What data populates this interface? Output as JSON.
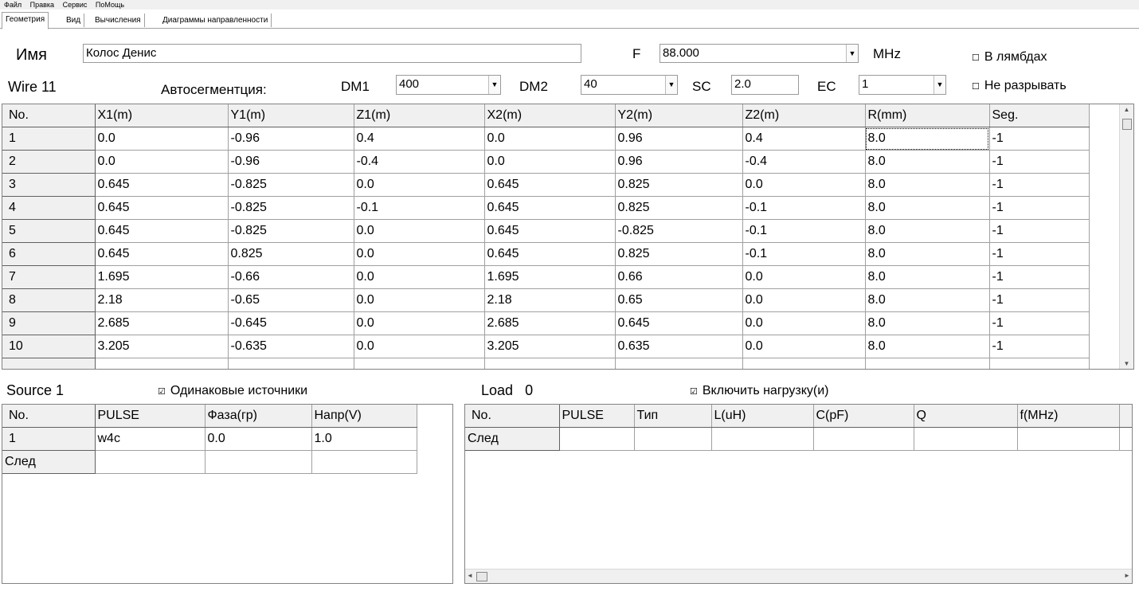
{
  "menu": [
    "Файл",
    "Правка",
    "Сервис",
    "ПоМощь"
  ],
  "tabs": [
    "Геометрия",
    "Вид",
    "Вычисления",
    "Диаграммы направленности"
  ],
  "name_label": "Имя",
  "name_value": "Колос Денис",
  "freq_label": "F",
  "freq_value": "88.000",
  "freq_unit": "MHz",
  "lambda_label": "В лямбдах",
  "no_break_label": "Не разрывать",
  "wire_label": "Wire 11",
  "autoseg_label": "Автосегментция:",
  "dm1_label": "DM1",
  "dm1_value": "400",
  "dm2_label": "DM2",
  "dm2_value": "40",
  "sc_label": "SC",
  "sc_value": "2.0",
  "ec_label": "EC",
  "ec_value": "1",
  "wires": {
    "headers": [
      "No.",
      "X1(m)",
      "Y1(m)",
      "Z1(m)",
      "X2(m)",
      "Y2(m)",
      "Z2(m)",
      "R(mm)",
      "Seg."
    ],
    "rows": [
      [
        "1",
        "0.0",
        "-0.96",
        "0.4",
        "0.0",
        "0.96",
        "0.4",
        "8.0",
        "-1"
      ],
      [
        "2",
        "0.0",
        "-0.96",
        "-0.4",
        "0.0",
        "0.96",
        "-0.4",
        "8.0",
        "-1"
      ],
      [
        "3",
        "0.645",
        "-0.825",
        "0.0",
        "0.645",
        "0.825",
        "0.0",
        "8.0",
        "-1"
      ],
      [
        "4",
        "0.645",
        "-0.825",
        "-0.1",
        "0.645",
        "0.825",
        "-0.1",
        "8.0",
        "-1"
      ],
      [
        "5",
        "0.645",
        "-0.825",
        "0.0",
        "0.645",
        "-0.825",
        "-0.1",
        "8.0",
        "-1"
      ],
      [
        "6",
        "0.645",
        "0.825",
        "0.0",
        "0.645",
        "0.825",
        "-0.1",
        "8.0",
        "-1"
      ],
      [
        "7",
        "1.695",
        "-0.66",
        "0.0",
        "1.695",
        "0.66",
        "0.0",
        "8.0",
        "-1"
      ],
      [
        "8",
        "2.18",
        "-0.65",
        "0.0",
        "2.18",
        "0.65",
        "0.0",
        "8.0",
        "-1"
      ],
      [
        "9",
        "2.685",
        "-0.645",
        "0.0",
        "2.685",
        "0.645",
        "0.0",
        "8.0",
        "-1"
      ],
      [
        "10",
        "3.205",
        "-0.635",
        "0.0",
        "3.205",
        "0.635",
        "0.0",
        "8.0",
        "-1"
      ]
    ]
  },
  "source_label": "Source 1",
  "same_sources_label": "Одинаковые источники",
  "sources": {
    "headers": [
      "No.",
      "PULSE",
      "Фаза(гр)",
      "Напр(V)"
    ],
    "rows": [
      [
        "1",
        "w4c",
        "0.0",
        "1.0"
      ]
    ],
    "next_label": "След"
  },
  "load_label": "Load",
  "load_count": "0",
  "include_loads_label": "Включить нагрузку(и)",
  "loads": {
    "headers": [
      "No.",
      "PULSE",
      "Тип",
      "L(uH)",
      "C(pF)",
      "Q",
      "f(MHz)"
    ],
    "next_label": "След"
  },
  "checkbox_on": "☑",
  "checkbox_off": "☐"
}
